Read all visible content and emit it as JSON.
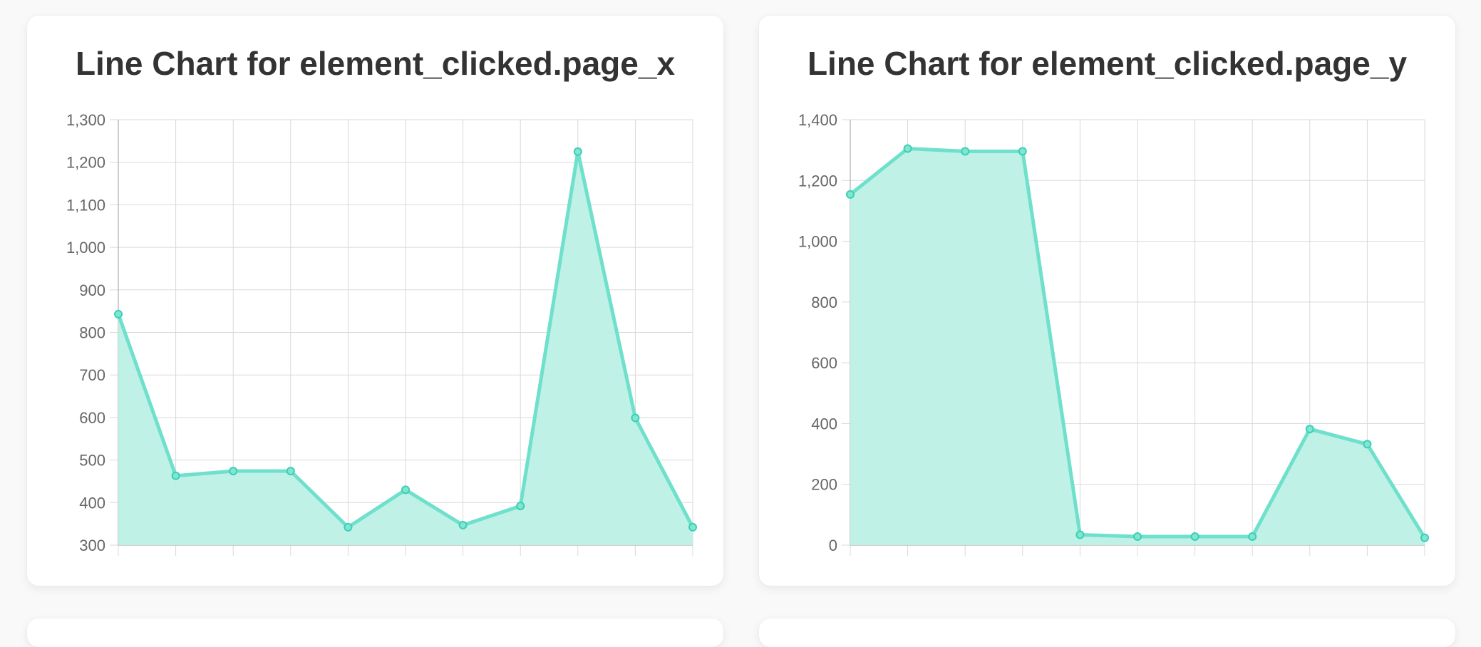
{
  "charts": [
    {
      "title": "Line Chart for element_clicked.page_x"
    },
    {
      "title": "Line Chart for element_clicked.page_y"
    }
  ],
  "colors": {
    "line": "#6fe0cc",
    "fill": "#bdf0e6",
    "point": "#3ccfb4",
    "grid": "#d9d9d9",
    "axis": "#bdbdbd",
    "tick_text": "#666666"
  },
  "chart_data": [
    {
      "type": "area",
      "title": "Line Chart for element_clicked.page_x",
      "xlabel": "",
      "ylabel": "",
      "x": [
        1,
        2,
        3,
        4,
        5,
        6,
        7,
        8,
        9,
        10,
        11
      ],
      "series": [
        {
          "values": [
            843,
            463,
            474,
            474,
            342,
            430,
            347,
            392,
            1225,
            599,
            342
          ]
        }
      ],
      "ylim": [
        300,
        1300
      ],
      "yticks": [
        "300",
        "400",
        "500",
        "600",
        "700",
        "800",
        "900",
        "1,000",
        "1,100",
        "1,200",
        "1,300"
      ],
      "ytick_values": [
        300,
        400,
        500,
        600,
        700,
        800,
        900,
        1000,
        1100,
        1200,
        1300
      ],
      "grid": true,
      "legend": "none"
    },
    {
      "type": "area",
      "title": "Line Chart for element_clicked.page_y",
      "xlabel": "",
      "ylabel": "",
      "x": [
        1,
        2,
        3,
        4,
        5,
        6,
        7,
        8,
        9,
        10,
        11
      ],
      "series": [
        {
          "values": [
            1154,
            1305,
            1296,
            1296,
            34,
            28,
            28,
            28,
            382,
            332,
            24
          ]
        }
      ],
      "ylim": [
        0,
        1400
      ],
      "yticks": [
        "0",
        "200",
        "400",
        "600",
        "800",
        "1,000",
        "1,200",
        "1,400"
      ],
      "ytick_values": [
        0,
        200,
        400,
        600,
        800,
        1000,
        1200,
        1400
      ],
      "grid": true,
      "legend": "none"
    }
  ]
}
